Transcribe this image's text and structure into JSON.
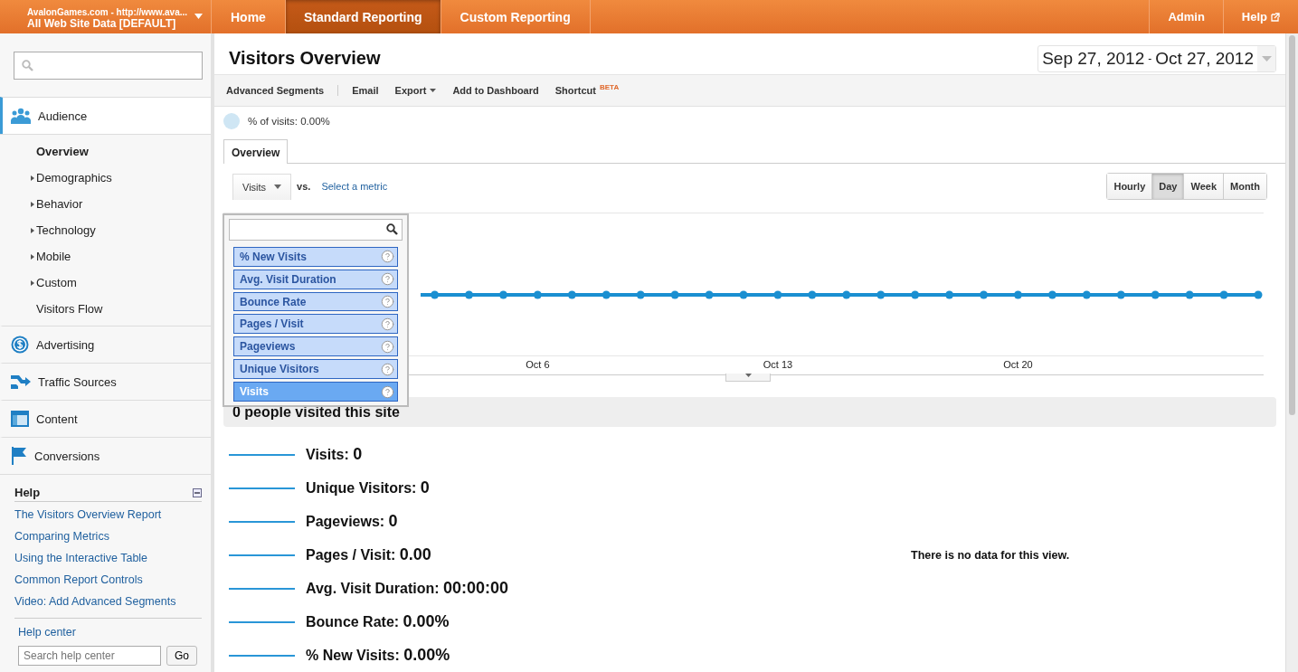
{
  "header": {
    "account": "AvalonGames.com - http://www.ava...",
    "profile": "All Web Site Data [DEFAULT]",
    "nav": [
      {
        "label": "Home",
        "selected": false
      },
      {
        "label": "Standard Reporting",
        "selected": true
      },
      {
        "label": "Custom Reporting",
        "selected": false
      }
    ],
    "right_nav": [
      "Admin",
      "Help"
    ]
  },
  "sidebar": {
    "sections": [
      {
        "label": "Audience",
        "kind": "audience",
        "selected": true,
        "children": [
          {
            "label": "Overview",
            "selected": true,
            "expandable": false
          },
          {
            "label": "Demographics",
            "selected": false,
            "expandable": true
          },
          {
            "label": "Behavior",
            "selected": false,
            "expandable": true
          },
          {
            "label": "Technology",
            "selected": false,
            "expandable": true
          },
          {
            "label": "Mobile",
            "selected": false,
            "expandable": true
          },
          {
            "label": "Custom",
            "selected": false,
            "expandable": true
          },
          {
            "label": "Visitors Flow",
            "selected": false,
            "expandable": false
          }
        ]
      },
      {
        "label": "Advertising",
        "kind": "advertising",
        "selected": false
      },
      {
        "label": "Traffic Sources",
        "kind": "traffic",
        "selected": false
      },
      {
        "label": "Content",
        "kind": "content",
        "selected": false
      },
      {
        "label": "Conversions",
        "kind": "conversions",
        "selected": false
      }
    ],
    "help": {
      "title": "Help",
      "links": [
        "The Visitors Overview Report",
        "Comparing Metrics",
        "Using the Interactive Table",
        "Common Report Controls",
        "Video: Add Advanced Segments"
      ],
      "center": "Help center",
      "search_placeholder": "Search help center",
      "go": "Go"
    }
  },
  "main": {
    "title": "Visitors Overview",
    "date_from": "Sep 27, 2012",
    "date_sep": "-",
    "date_to": "Oct 27, 2012",
    "toolbar": [
      {
        "label": "Advanced Segments",
        "kind": "plain"
      },
      {
        "label": "Email",
        "kind": "plain"
      },
      {
        "label": "Export",
        "kind": "menu"
      },
      {
        "label": "Add to Dashboard",
        "kind": "plain"
      },
      {
        "label": "Shortcut",
        "kind": "badge",
        "badge": "BETA"
      }
    ],
    "segment": "% of visits: 0.00%",
    "tabs": [
      {
        "label": "Overview",
        "selected": true
      }
    ],
    "metric": "Visits",
    "vs": "vs.",
    "compare": "Select a metric",
    "granularity": [
      {
        "label": "Hourly",
        "selected": false
      },
      {
        "label": "Day",
        "selected": true
      },
      {
        "label": "Week",
        "selected": false
      },
      {
        "label": "Month",
        "selected": false
      }
    ],
    "metric_menu": [
      {
        "label": "% New Visits",
        "selected": false
      },
      {
        "label": "Avg. Visit Duration",
        "selected": false
      },
      {
        "label": "Bounce Rate",
        "selected": false
      },
      {
        "label": "Pages / Visit",
        "selected": false
      },
      {
        "label": "Pageviews",
        "selected": false
      },
      {
        "label": "Unique Visitors",
        "selected": false
      },
      {
        "label": "Visits",
        "selected": true
      }
    ],
    "x_labels": [
      "Oct 6",
      "Oct 13",
      "Oct 20"
    ],
    "summary": "0 people visited this site",
    "metrics": [
      {
        "label": "Visits:",
        "value": "0"
      },
      {
        "label": "Unique Visitors:",
        "value": "0"
      },
      {
        "label": "Pageviews:",
        "value": "0"
      },
      {
        "label": "Pages / Visit:",
        "value": "0.00"
      },
      {
        "label": "Avg. Visit Duration:",
        "value": "00:00:00"
      },
      {
        "label": "Bounce Rate:",
        "value": "0.00%"
      },
      {
        "label": "% New Visits:",
        "value": "0.00%"
      }
    ],
    "no_data": "There is no data for this view."
  }
}
